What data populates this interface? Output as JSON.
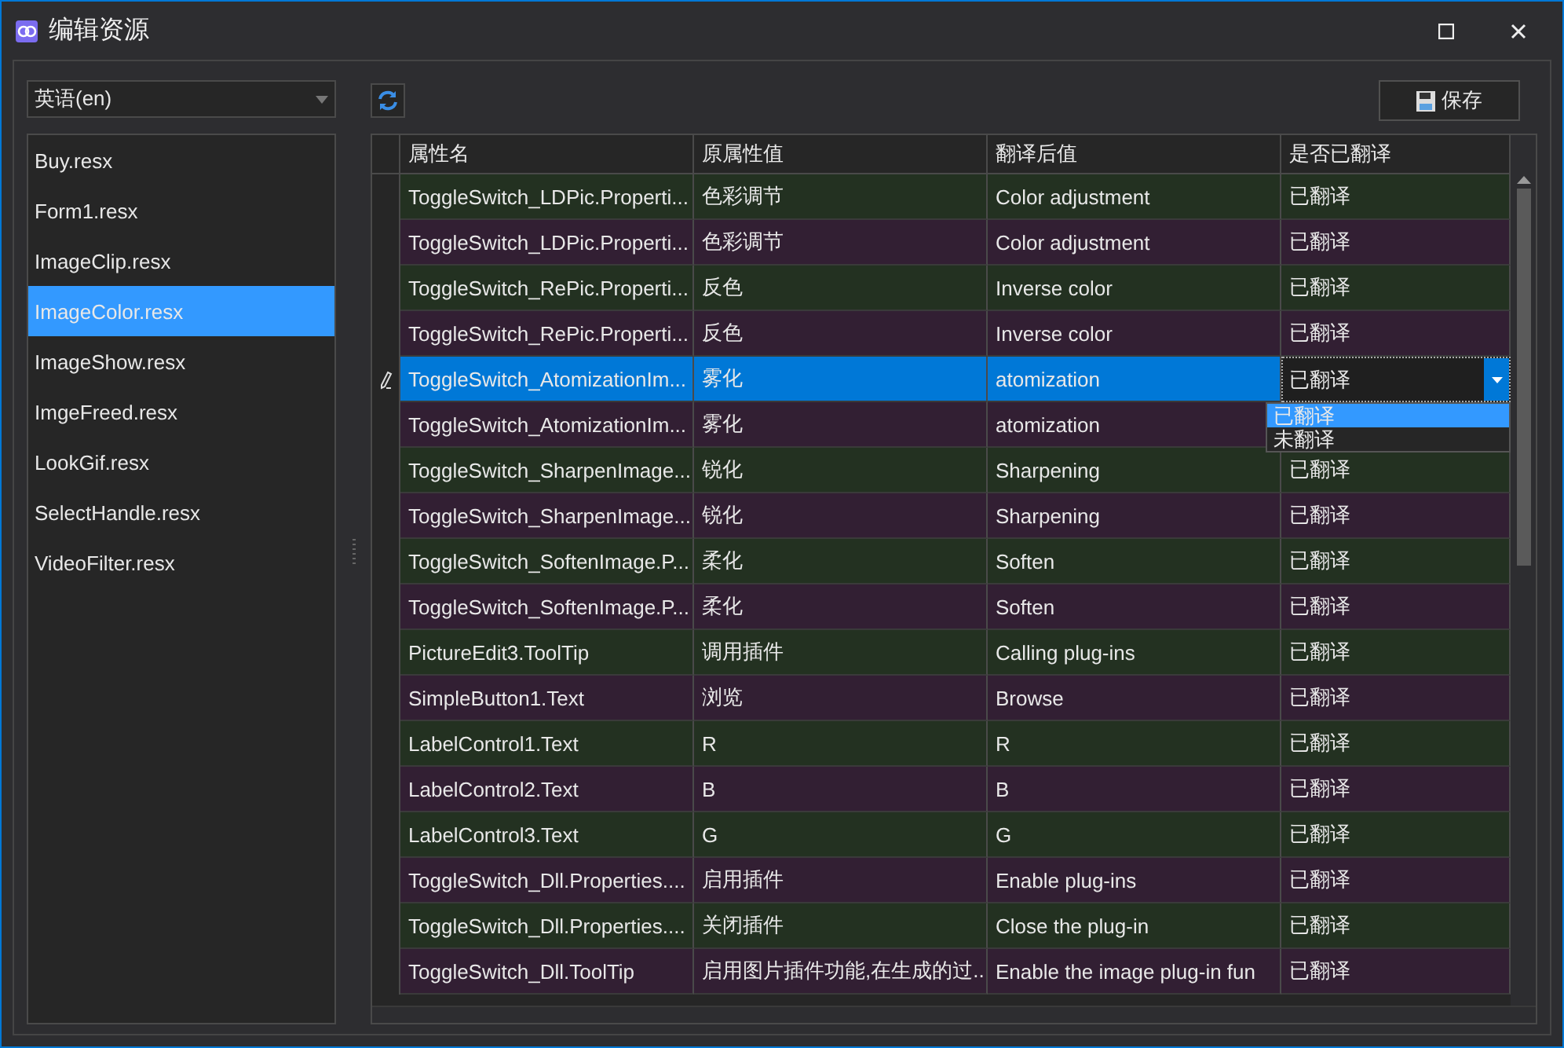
{
  "window": {
    "title": "编辑资源"
  },
  "language_select": {
    "value": "英语(en)"
  },
  "files": [
    {
      "name": "Buy.resx",
      "selected": false
    },
    {
      "name": "Form1.resx",
      "selected": false
    },
    {
      "name": "ImageClip.resx",
      "selected": false
    },
    {
      "name": "ImageColor.resx",
      "selected": true
    },
    {
      "name": "ImageShow.resx",
      "selected": false
    },
    {
      "name": "ImgeFreed.resx",
      "selected": false
    },
    {
      "name": "LookGif.resx",
      "selected": false
    },
    {
      "name": "SelectHandle.resx",
      "selected": false
    },
    {
      "name": "VideoFilter.resx",
      "selected": false
    }
  ],
  "save_button": {
    "label": "保存"
  },
  "table": {
    "columns": [
      "属性名",
      "原属性值",
      "翻译后值",
      "是否已翻译"
    ],
    "rows": [
      {
        "cells": [
          "ToggleSwitch_LDPic.Properti...",
          "色彩调节",
          "Color adjustment",
          "已翻译"
        ],
        "selected": false
      },
      {
        "cells": [
          "ToggleSwitch_LDPic.Properti...",
          "色彩调节",
          "Color adjustment",
          "已翻译"
        ],
        "selected": false
      },
      {
        "cells": [
          "ToggleSwitch_RePic.Properti...",
          "反色",
          "Inverse color",
          "已翻译"
        ],
        "selected": false
      },
      {
        "cells": [
          "ToggleSwitch_RePic.Properti...",
          "反色",
          "Inverse color",
          "已翻译"
        ],
        "selected": false
      },
      {
        "cells": [
          "ToggleSwitch_AtomizationIm...",
          "雾化",
          "atomization",
          "已翻译"
        ],
        "selected": true
      },
      {
        "cells": [
          "ToggleSwitch_AtomizationIm...",
          "雾化",
          "atomization"
        ],
        "selected": false
      },
      {
        "cells": [
          "ToggleSwitch_SharpenImage...",
          "锐化",
          "Sharpening",
          "已翻译"
        ],
        "selected": false
      },
      {
        "cells": [
          "ToggleSwitch_SharpenImage...",
          "锐化",
          "Sharpening",
          "已翻译"
        ],
        "selected": false
      },
      {
        "cells": [
          "ToggleSwitch_SoftenImage.P...",
          "柔化",
          "Soften",
          "已翻译"
        ],
        "selected": false
      },
      {
        "cells": [
          "ToggleSwitch_SoftenImage.P...",
          "柔化",
          "Soften",
          "已翻译"
        ],
        "selected": false
      },
      {
        "cells": [
          "PictureEdit3.ToolTip",
          "调用插件",
          "Calling plug-ins",
          "已翻译"
        ],
        "selected": false
      },
      {
        "cells": [
          "SimpleButton1.Text",
          "浏览",
          "Browse",
          "已翻译"
        ],
        "selected": false
      },
      {
        "cells": [
          "LabelControl1.Text",
          "R",
          "R",
          "已翻译"
        ],
        "selected": false
      },
      {
        "cells": [
          "LabelControl2.Text",
          "B",
          "B",
          "已翻译"
        ],
        "selected": false
      },
      {
        "cells": [
          "LabelControl3.Text",
          "G",
          "G",
          "已翻译"
        ],
        "selected": false
      },
      {
        "cells": [
          "ToggleSwitch_Dll.Properties....",
          "启用插件",
          "Enable plug-ins",
          "已翻译"
        ],
        "selected": false
      },
      {
        "cells": [
          "ToggleSwitch_Dll.Properties....",
          "关闭插件",
          "Close the plug-in",
          "已翻译"
        ],
        "selected": false
      },
      {
        "cells": [
          "ToggleSwitch_Dll.ToolTip",
          "启用图片插件功能,在生成的过...",
          "Enable the image plug-in fun",
          "已翻译"
        ],
        "selected": false
      }
    ]
  },
  "status_dropdown": {
    "options": [
      {
        "label": "已翻译",
        "selected": true
      },
      {
        "label": "未翻译",
        "selected": false
      }
    ]
  }
}
